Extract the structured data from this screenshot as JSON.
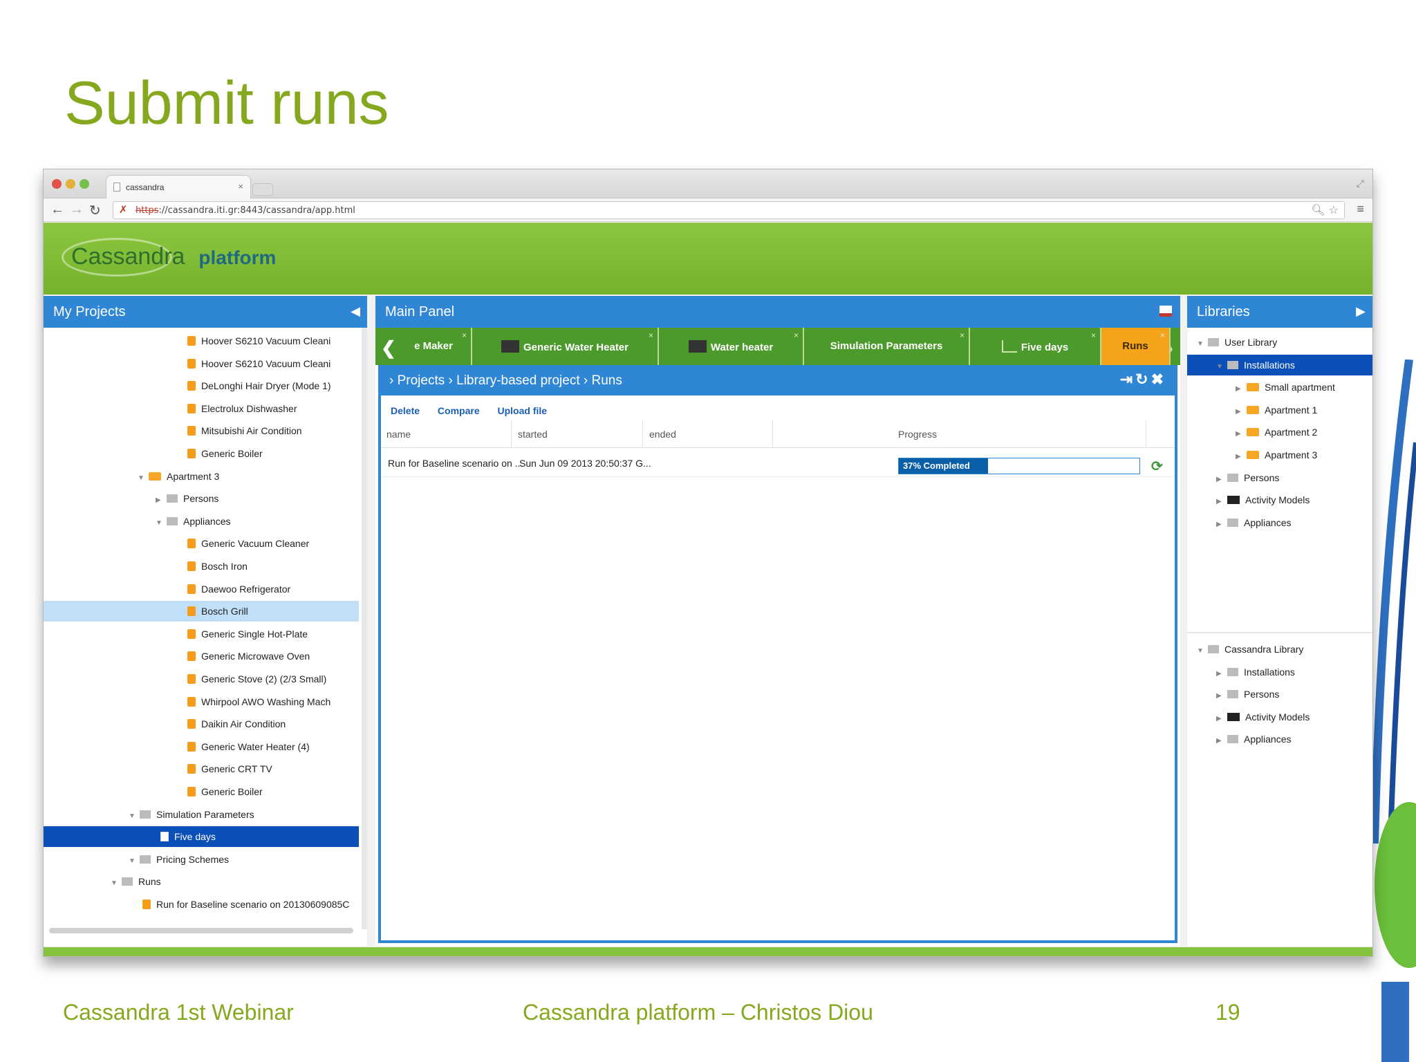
{
  "slide": {
    "title": "Submit runs",
    "footer_left": "Cassandra 1st Webinar",
    "footer_center": "Cassandra platform – Christos Diou",
    "page_number": "19"
  },
  "browser": {
    "tab_title": "cassandra",
    "url_scheme": "https",
    "url_rest": "://cassandra.iti.gr:8443/cassandra/app.html"
  },
  "app": {
    "logo_text": "Cassandra",
    "logo_suffix": "platform",
    "accent_color": "#8cc63f",
    "header_blue": "#2f86d4"
  },
  "left_panel": {
    "title": "My Projects",
    "tree": [
      {
        "label": "Hoover S6210 Vacuum Cleani",
        "icon": "installation-icon",
        "indent": 3
      },
      {
        "label": "Hoover S6210 Vacuum Cleani",
        "icon": "installation-icon",
        "indent": 3
      },
      {
        "label": "DeLonghi Hair Dryer (Mode 1)",
        "icon": "installation-icon",
        "indent": 3
      },
      {
        "label": "Electrolux Dishwasher",
        "icon": "installation-icon",
        "indent": 3
      },
      {
        "label": "Mitsubishi Air Condition",
        "icon": "installation-icon",
        "indent": 3
      },
      {
        "label": "Generic Boiler",
        "icon": "installation-icon",
        "indent": 3
      },
      {
        "label": "Apartment 3",
        "icon": "folder-icon",
        "indent": 1,
        "arrow": "▼"
      },
      {
        "label": "Persons",
        "icon": "persons-icon",
        "indent": 2,
        "arrow": "▶"
      },
      {
        "label": "Appliances",
        "icon": "appliances-icon",
        "indent": 2,
        "arrow": "▼"
      },
      {
        "label": "Generic Vacuum Cleaner",
        "icon": "installation-icon",
        "indent": 3
      },
      {
        "label": "Bosch Iron",
        "icon": "installation-icon",
        "indent": 3
      },
      {
        "label": "Daewoo Refrigerator",
        "icon": "installation-icon",
        "indent": 3
      },
      {
        "label": "Bosch Grill",
        "icon": "installation-icon",
        "indent": 3,
        "state": "hl"
      },
      {
        "label": "Generic Single Hot-Plate",
        "icon": "installation-icon",
        "indent": 3
      },
      {
        "label": "Generic Microwave Oven",
        "icon": "installation-icon",
        "indent": 3
      },
      {
        "label": "Generic Stove (2) (2/3 Small)",
        "icon": "installation-icon",
        "indent": 3
      },
      {
        "label": "Whirpool AWO Washing Mach",
        "icon": "installation-icon",
        "indent": 3
      },
      {
        "label": "Daikin Air Condition",
        "icon": "installation-icon",
        "indent": 3
      },
      {
        "label": "Generic Water Heater (4)",
        "icon": "installation-icon",
        "indent": 3
      },
      {
        "label": "Generic CRT TV",
        "icon": "installation-icon",
        "indent": 3
      },
      {
        "label": "Generic Boiler",
        "icon": "installation-icon",
        "indent": 3
      },
      {
        "label": "Simulation Parameters",
        "icon": "chart-icon",
        "indent": 0.5,
        "arrow": "▼"
      },
      {
        "label": "Five days",
        "icon": "document-icon",
        "indent": 1.5,
        "state": "sel"
      },
      {
        "label": "Pricing Schemes",
        "icon": "pricing-icon",
        "indent": 0.5,
        "arrow": "▼"
      },
      {
        "label": "Runs",
        "icon": "runs-icon",
        "indent": -0.5,
        "arrow": "▼"
      },
      {
        "label": "Run for Baseline scenario on 20130609085C",
        "icon": "installation-icon",
        "indent": 0.5
      }
    ]
  },
  "main_panel": {
    "title": "Main Panel",
    "tabs": [
      {
        "label": "e Maker",
        "icon": "none"
      },
      {
        "label": "Generic Water Heater",
        "icon": "heater-icon"
      },
      {
        "label": "Water heater",
        "icon": "heater-icon"
      },
      {
        "label": "Simulation Parameters",
        "icon": "none"
      },
      {
        "label": "Five days",
        "icon": "chart-icon"
      },
      {
        "label": "Runs",
        "icon": "none",
        "active": true
      }
    ],
    "breadcrumb": "› Projects › Library-based project › Runs",
    "actions": [
      "Delete",
      "Compare",
      "Upload file"
    ],
    "columns": [
      "name",
      "started",
      "ended",
      "Progress"
    ],
    "rows": [
      {
        "name": "Run for Baseline scenario on ...",
        "started": "Sun Jun 09 2013 20:50:37 G...",
        "ended": "",
        "progress_label": "37% Completed",
        "progress_value": 0.37
      }
    ]
  },
  "right_panel": {
    "title": "Libraries",
    "user_library": [
      {
        "label": "User Library",
        "icon": "user-library-icon",
        "level": 0,
        "arrow": "▼"
      },
      {
        "label": "Installations",
        "icon": "installations-icon",
        "level": 1,
        "arrow": "▼",
        "state": "sel"
      },
      {
        "label": "Small apartment",
        "icon": "folder-icon",
        "level": 2,
        "arrow": "▶"
      },
      {
        "label": "Apartment 1",
        "icon": "folder-icon",
        "level": 2,
        "arrow": "▶"
      },
      {
        "label": "Apartment 2",
        "icon": "folder-icon",
        "level": 2,
        "arrow": "▶"
      },
      {
        "label": "Apartment 3",
        "icon": "folder-icon",
        "level": 2,
        "arrow": "▶"
      },
      {
        "label": "Persons",
        "icon": "persons-icon",
        "level": 1,
        "arrow": "▶"
      },
      {
        "label": "Activity Models",
        "icon": "activity-icon",
        "level": 1,
        "arrow": "▶"
      },
      {
        "label": "Appliances",
        "icon": "appliances-icon",
        "level": 1,
        "arrow": "▶"
      }
    ],
    "cassandra_library": [
      {
        "label": "Cassandra Library",
        "icon": "cassandra-library-icon",
        "level": 0,
        "arrow": "▼"
      },
      {
        "label": "Installations",
        "icon": "installations-icon",
        "level": 1,
        "arrow": "▶"
      },
      {
        "label": "Persons",
        "icon": "persons-icon",
        "level": 1,
        "arrow": "▶"
      },
      {
        "label": "Activity Models",
        "icon": "activity-icon",
        "level": 1,
        "arrow": "▶"
      },
      {
        "label": "Appliances",
        "icon": "appliances-icon",
        "level": 1,
        "arrow": "▶"
      }
    ]
  }
}
